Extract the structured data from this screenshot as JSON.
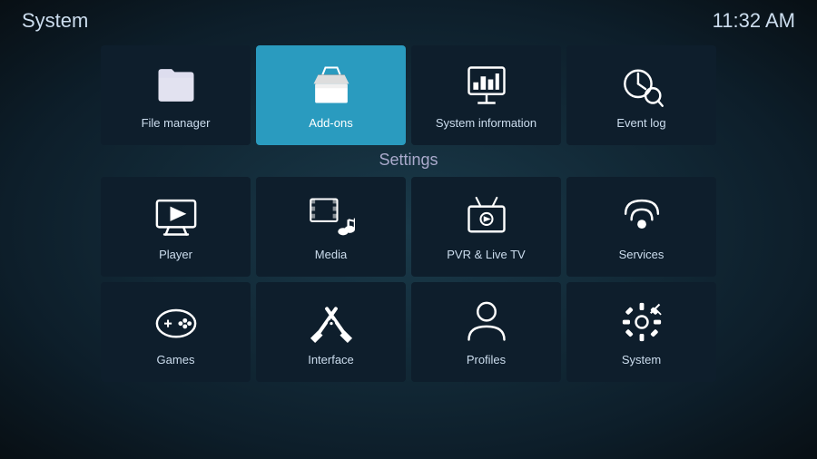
{
  "header": {
    "title": "System",
    "time": "11:32 AM"
  },
  "top_row": [
    {
      "id": "file-manager",
      "label": "File manager",
      "active": false
    },
    {
      "id": "add-ons",
      "label": "Add-ons",
      "active": true
    },
    {
      "id": "system-information",
      "label": "System information",
      "active": false
    },
    {
      "id": "event-log",
      "label": "Event log",
      "active": false
    }
  ],
  "settings_label": "Settings",
  "settings_row1": [
    {
      "id": "player",
      "label": "Player"
    },
    {
      "id": "media",
      "label": "Media"
    },
    {
      "id": "pvr-live-tv",
      "label": "PVR & Live TV"
    },
    {
      "id": "services",
      "label": "Services"
    }
  ],
  "settings_row2": [
    {
      "id": "games",
      "label": "Games"
    },
    {
      "id": "interface",
      "label": "Interface"
    },
    {
      "id": "profiles",
      "label": "Profiles"
    },
    {
      "id": "system",
      "label": "System"
    }
  ]
}
